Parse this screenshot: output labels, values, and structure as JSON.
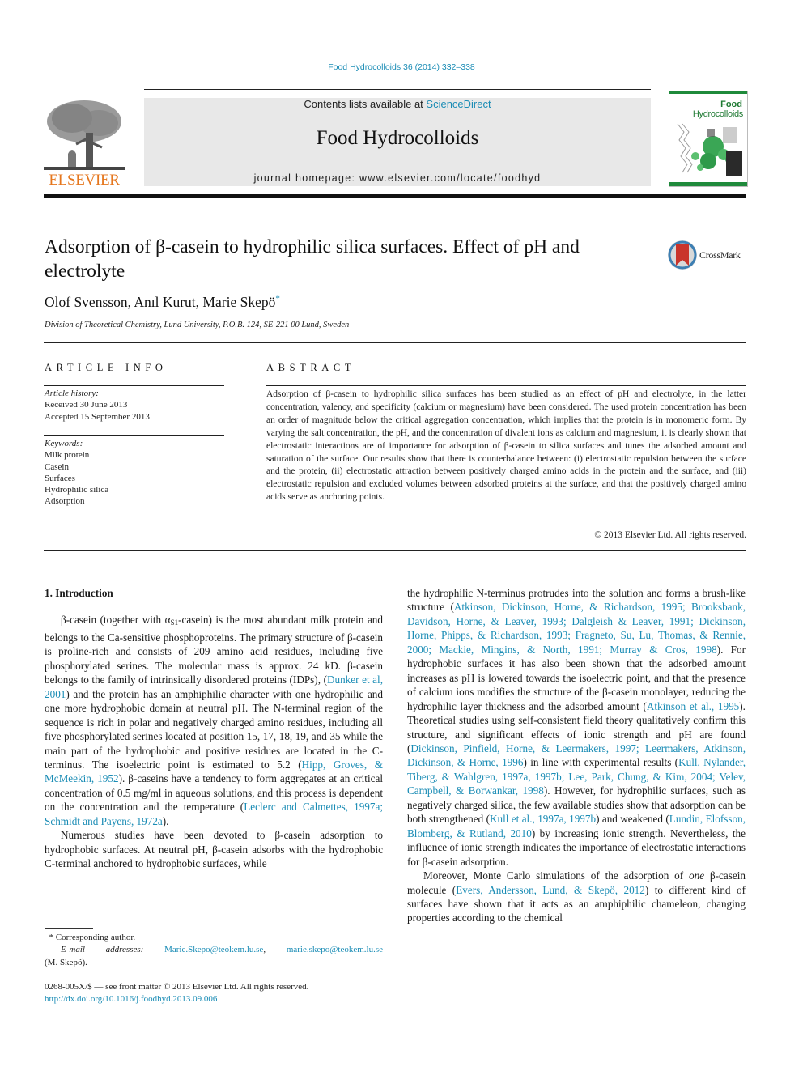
{
  "header": {
    "citation": "Food Hydrocolloids 36 (2014) 332–338",
    "contents_prefix": "Contents lists available at ",
    "contents_link": "ScienceDirect",
    "journal_name": "Food Hydrocolloids",
    "homepage": "journal homepage: www.elsevier.com/locate/foodhyd",
    "publisher_logo_text": "ELSEVIER",
    "cover_title_line1": "Food",
    "cover_title_line2": "Hydrocolloids",
    "crossmark_label": "CrossMark"
  },
  "article": {
    "title": "Adsorption of β-casein to hydrophilic silica surfaces. Effect of pH and electrolyte",
    "authors": "Olof Svensson, Anıl Kurut, Marie Skepö",
    "corresponding_mark": "*",
    "affiliation": "Division of Theoretical Chemistry, Lund University, P.O.B. 124, SE-221 00 Lund, Sweden"
  },
  "article_info": {
    "heading": "ARTICLE INFO",
    "history_label": "Article history:",
    "received": "Received 30 June 2013",
    "accepted": "Accepted 15 September 2013",
    "keywords_label": "Keywords:",
    "keywords": [
      "Milk protein",
      "Casein",
      "Surfaces",
      "Hydrophilic silica",
      "Adsorption"
    ]
  },
  "abstract": {
    "heading": "ABSTRACT",
    "text": "Adsorption of β-casein to hydrophilic silica surfaces has been studied as an effect of pH and electrolyte, in the latter concentration, valency, and specificity (calcium or magnesium) have been considered. The used protein concentration has been an order of magnitude below the critical aggregation concentration, which implies that the protein is in monomeric form. By varying the salt concentration, the pH, and the concentration of divalent ions as calcium and magnesium, it is clearly shown that electrostatic in­teractions are of importance for adsorption of β-casein to silica surfaces and tunes the adsorbed amount and saturation of the surface. Our results show that there is counterbalance between: (i) electrostatic repulsion between the surface and the protein, (ii) electrostatic attraction between positively charged amino acids in the protein and the surface, and (iii) electrostatic repulsion and excluded volumes be­tween adsorbed proteins at the surface, and that the positively charged amino acids serve as anchoring points.",
    "copyright": "© 2013 Elsevier Ltd. All rights reserved."
  },
  "body": {
    "section_heading": "1.  Introduction",
    "p1": {
      "t1": "β-casein (together with α",
      "sub": "S1",
      "t2": "-casein) is the most abundant milk protein and belongs to the Ca-sensitive phosphoproteins. The pri­mary structure of β-casein is proline-rich and consists of 209 amino acid residues, including five phosphorylated serines. The molecular mass is approx. 24 kD. β-casein belongs to the family of intrinsically disordered proteins (IDPs), (",
      "ref1": "Dunker et al, 2001",
      "t3": ") and the protein has an amphiphilic character with one hydrophilic and one more hy­drophobic domain at neutral pH. The N-terminal region of the sequence is rich in polar and negatively charged amino residues, including all five phosphorylated serines located at position 15, 17, 18, 19, and 35 while the main part of the hydrophobic and positive residues are located in the C-terminus. The isoelectric point is estimated to 5.2 (",
      "ref2": "Hipp, Groves, & McMeekin, 1952",
      "t4": "). β-caseins have a tendency to form aggregates at an critical concentration of 0.5 mg/ml in aqueous solutions, and this process is dependent on the concentration and the temperature (",
      "ref3": "Leclerc and Calmettes, 1997a; Schmidt and Payens, 1972a",
      "t5": ")."
    },
    "p2": {
      "t1": "Numerous studies have been devoted to β-casein adsorption to hydrophobic surfaces. At neutral pH, β-casein adsorbs with the hydrophobic C-terminal anchored to hydrophobic surfaces, while the hydrophilic N-terminus protrudes into the solution and forms a brush-like structure (",
      "ref1": "Atkinson, Dickinson, Horne, & Richardson, 1995; Brooksbank, Davidson, Horne, & Leaver, 1993; Dalgleish & Leaver, 1991; Dickinson, Horne, Phipps, & Richardson, 1993; Fragneto, Su, Lu, Thomas, & Rennie, 2000; Mackie, Mingins, & North, 1991; Murray & Cros, 1998",
      "t2": "). For hydrophobic surfaces it has also been shown that the adsorbed amount increases as pH is lowered towards the isoelectric point, and that the presence of calcium ions modifies the structure of the β-casein monolayer, reducing the hydrophilic layer thickness and the adsorbed amount (",
      "ref2": "Atkinson et al., 1995",
      "t3": "). Theoretical studies using self-consistent field theory qualitatively confirm this structure, and significant effects of ionic strength and pH are found (",
      "ref3": "Dickinson, Pinfield, Horne, & Leermakers, 1997; Leermakers, Atkinson, Dickinson, & Horne, 1996",
      "t4": ") in line with experimental results (",
      "ref4": "Kull, Nylander, Tiberg, & Wahlgren, 1997a, 1997b; Lee, Park, Chung, & Kim, 2004; Velev, Campbell, & Borwankar, 1998",
      "t5": "). However, for hydrophilic surfaces, such as negatively charged silica, the few available studies show that adsorption can be both strengthened (",
      "ref5": "Kull et al., 1997a, 1997b",
      "t6": ") and weakened (",
      "ref6": "Lundin, Elofsson, Blomberg, & Rutland, 2010",
      "t7": ") by increasing ionic strength. Nevertheless, the influence of ionic strength indicates the importance of electrostatic interactions for β-casein adsorption."
    },
    "p3": {
      "t1": "Moreover, Monte Carlo simulations of the adsorption of ",
      "em": "one",
      "t2": " β-casein molecule (",
      "ref1": "Evers, Andersson, Lund, & Skepö, 2012",
      "t3": ") to different kind of surfaces have shown that it acts as an amphiphilic chameleon, changing properties according to the chemical"
    }
  },
  "footnotes": {
    "star": "*",
    "corresponding": "Corresponding author.",
    "email_label": "E-mail addresses:",
    "email1": "Marie.Skepo@teokem.lu.se",
    "email_sep": ",",
    "email2": "marie.skepo@teokem.lu.se",
    "email_owner": "(M. Skepö).",
    "front_matter": "0268-005X/$ — see front matter © 2013 Elsevier Ltd. All rights reserved.",
    "doi": "http://dx.doi.org/10.1016/j.foodhyd.2013.09.006"
  },
  "colors": {
    "link": "#1a8cb5",
    "elsevier_orange": "#e5761d",
    "cover_green": "#1f8a3b",
    "banner_gray": "#e8e8e8"
  }
}
